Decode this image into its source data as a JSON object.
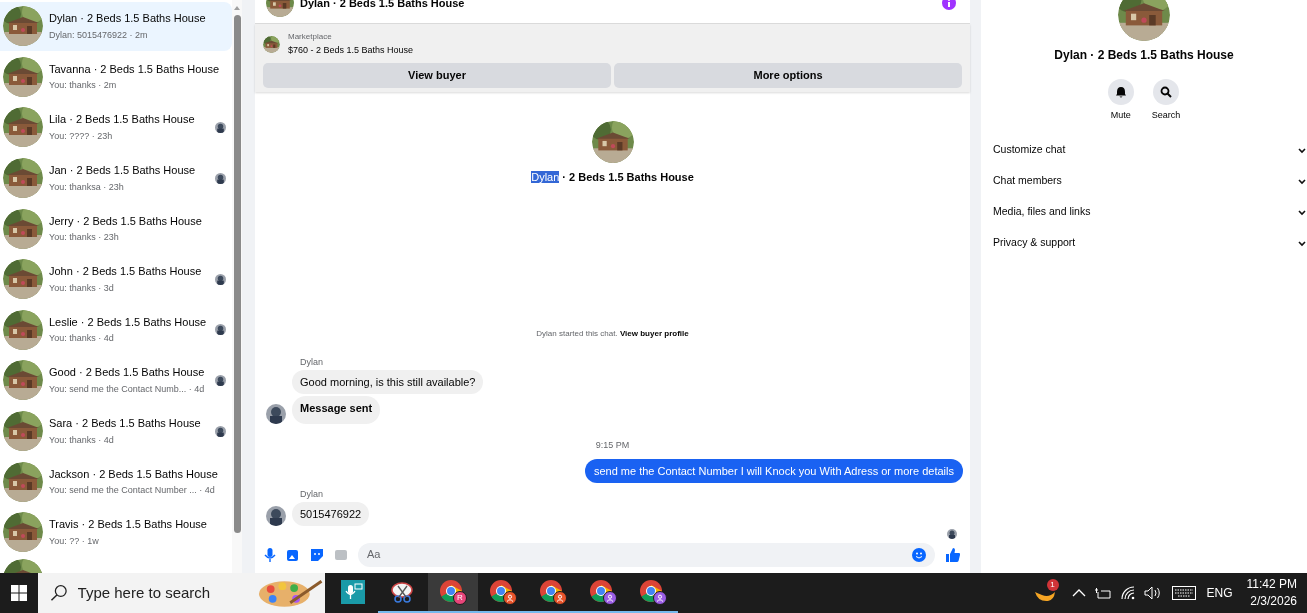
{
  "conversations": [
    {
      "name": "Dylan · 2 Beds 1.5 Baths House",
      "preview": "Dylan: 5015476922 · 2m",
      "selected": true,
      "seen_avatar": false
    },
    {
      "name": "Tavanna · 2 Beds 1.5 Baths House",
      "preview": "You: thanks · 2m",
      "selected": false,
      "seen_avatar": false
    },
    {
      "name": "Lila · 2 Beds 1.5 Baths House",
      "preview": "You: ???? · 23h",
      "selected": false,
      "seen_avatar": true
    },
    {
      "name": "Jan · 2 Beds 1.5 Baths House",
      "preview": "You: thanksa · 23h",
      "selected": false,
      "seen_avatar": true
    },
    {
      "name": "Jerry · 2 Beds 1.5 Baths House",
      "preview": "You: thanks · 23h",
      "selected": false,
      "seen_avatar": false
    },
    {
      "name": "John · 2 Beds 1.5 Baths House",
      "preview": "You: thanks · 3d",
      "selected": false,
      "seen_avatar": true
    },
    {
      "name": "Leslie · 2 Beds 1.5 Baths House",
      "preview": "You: thanks · 4d",
      "selected": false,
      "seen_avatar": true
    },
    {
      "name": "Good · 2 Beds 1.5 Baths House",
      "preview": "You: send me the Contact Numb... · 4d",
      "selected": false,
      "seen_avatar": true
    },
    {
      "name": "Sara · 2 Beds 1.5 Baths House",
      "preview": "You: thanks · 4d",
      "selected": false,
      "seen_avatar": true
    },
    {
      "name": "Jackson · 2 Beds 1.5 Baths House",
      "preview": "You: send me the Contact Number ... · 4d",
      "selected": false,
      "seen_avatar": false
    },
    {
      "name": "Travis · 2 Beds 1.5 Baths House",
      "preview": "You: ?? · 1w",
      "selected": false,
      "seen_avatar": false
    }
  ],
  "chat": {
    "title": "Dylan · 2 Beds 1.5 Baths House",
    "listing": {
      "label": "Marketplace",
      "price": "$760 - 2 Beds 1.5 Baths House"
    },
    "buttons": [
      "View buyer",
      "More options"
    ],
    "profile": {
      "selected_text": "Dylan",
      "rest": " · 2 Beds 1.5 Baths House"
    },
    "notice": {
      "text": "Dylan started this chat.",
      "link": "View buyer profile"
    },
    "messages": [
      {
        "kind": "sender",
        "text": "Dylan"
      },
      {
        "kind": "incoming",
        "text": "Good morning, is this still available?",
        "bold": false,
        "avatar": false
      },
      {
        "kind": "incoming",
        "text": "Message sent",
        "bold": true,
        "avatar": true
      },
      {
        "kind": "time",
        "text": "9:15 PM"
      },
      {
        "kind": "outgoing",
        "text": "send me the Contact Number I will Knock you With Adress or more details"
      },
      {
        "kind": "sender",
        "text": "Dylan"
      },
      {
        "kind": "incoming",
        "text": "5015476922",
        "bold": false,
        "avatar": true
      },
      {
        "kind": "read_receipt"
      }
    ],
    "composer": {
      "placeholder": "Aa"
    }
  },
  "details": {
    "title": "Dylan · 2 Beds 1.5 Baths House",
    "actions": [
      {
        "kind": "mute",
        "label": "Mute"
      },
      {
        "kind": "search",
        "label": "Search"
      }
    ],
    "sections": [
      {
        "label": "Customize chat",
        "expanded": false
      },
      {
        "label": "Chat members",
        "expanded": false
      },
      {
        "label": "Media, files and links",
        "expanded": false
      },
      {
        "label": "Privacy & support",
        "expanded": false
      }
    ]
  },
  "taskbar": {
    "search_placeholder": "Type here to search",
    "apps": [
      {
        "kind": "mic",
        "open": false,
        "selected": false
      },
      {
        "kind": "snip",
        "open": true,
        "selected": false
      },
      {
        "kind": "chrome",
        "open": true,
        "selected": true,
        "badge": "R",
        "color": "#e8457a"
      },
      {
        "kind": "chrome",
        "open": true,
        "selected": false,
        "color": "#e8542a"
      },
      {
        "kind": "chrome",
        "open": true,
        "selected": false,
        "color": "#e8542a"
      },
      {
        "kind": "chrome",
        "open": true,
        "selected": false,
        "color": "#9b5de5"
      },
      {
        "kind": "chrome",
        "open": true,
        "selected": false,
        "color": "#9b5de5"
      }
    ],
    "weather_badge": "1",
    "language": "ENG",
    "time": "11:42 PM",
    "date": "2/3/2026"
  }
}
